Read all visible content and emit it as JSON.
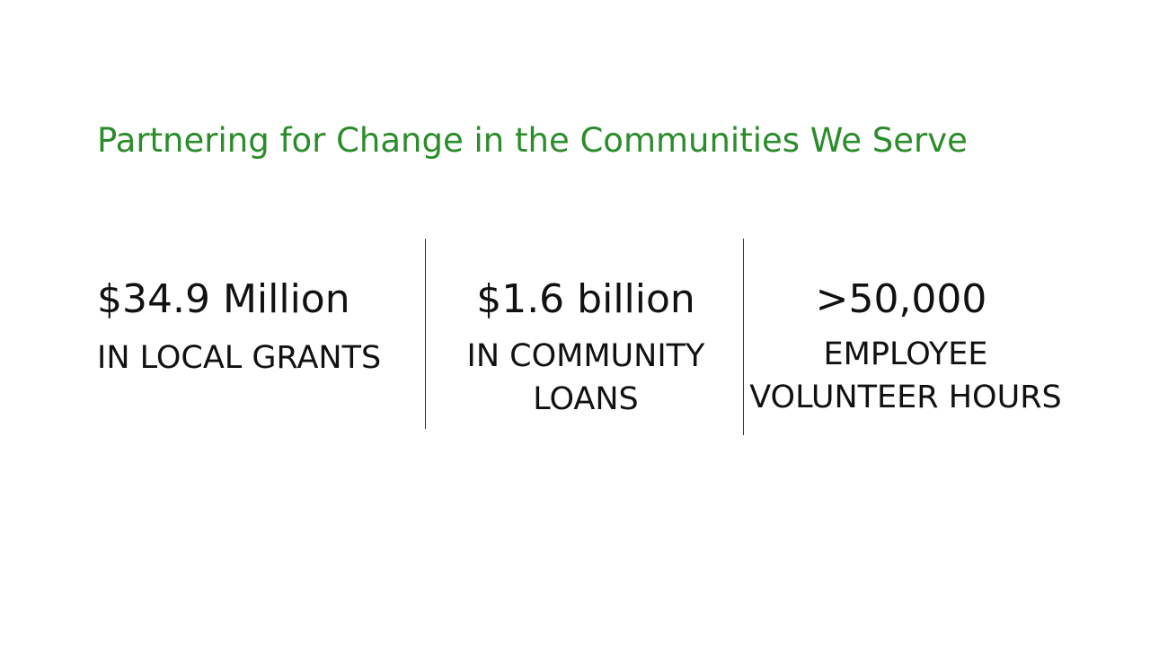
{
  "slide": {
    "title": "Partnering for Change in the Communities We Serve",
    "title_color": "#2a8c2a"
  },
  "stats": [
    {
      "value": "$34.9 Million",
      "label_lines": [
        "IN LOCAL GRANTS"
      ]
    },
    {
      "value": "$1.6 billion",
      "label_lines": [
        "IN COMMUNITY",
        "LOANS"
      ]
    },
    {
      "value": ">50,000",
      "label_lines": [
        "EMPLOYEE",
        "VOLUNTEER HOURS"
      ]
    }
  ]
}
